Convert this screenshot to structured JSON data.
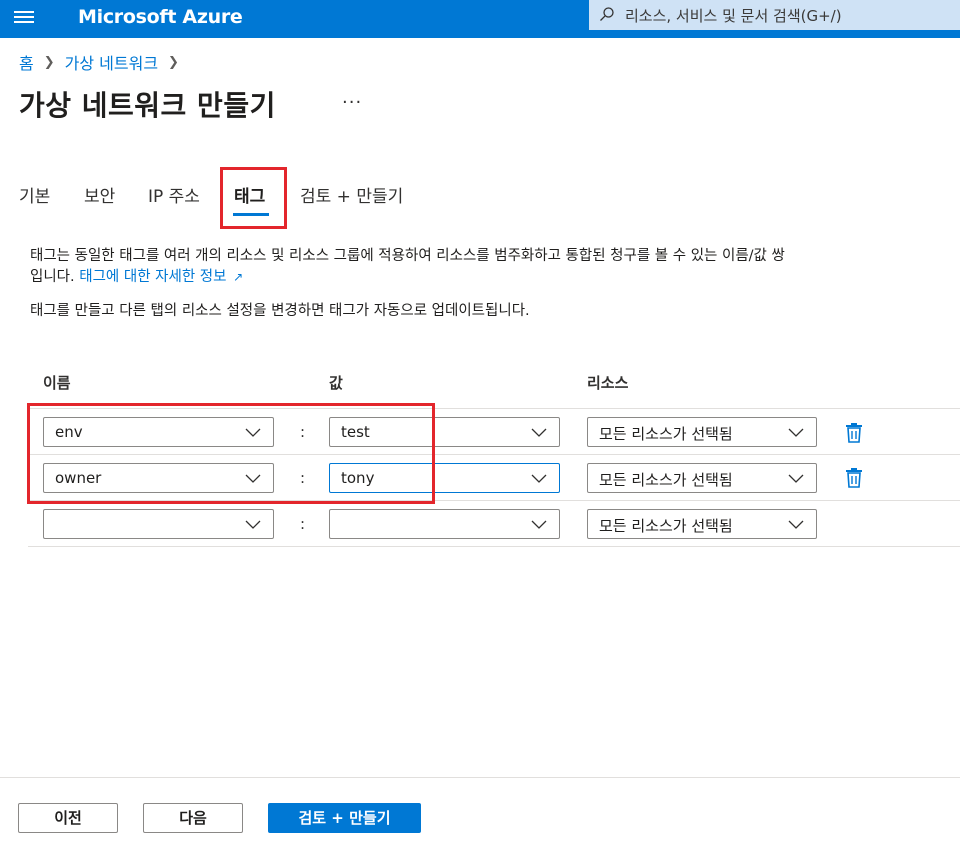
{
  "topbar": {
    "brand": "Microsoft Azure",
    "search_placeholder": "리소스, 서비스 및 문서 검색(G+/)"
  },
  "breadcrumb": {
    "home": "홈",
    "current": "가상 네트워크"
  },
  "page": {
    "title": "가상 네트워크 만들기",
    "more": "···"
  },
  "tabs": [
    {
      "label": "기본"
    },
    {
      "label": "보안"
    },
    {
      "label": "IP 주소"
    },
    {
      "label": "태그",
      "active": true
    },
    {
      "label": "검토 + 만들기"
    }
  ],
  "description": {
    "line1": "태그는 동일한 태그를 여러 개의 리소스 및 리소스 그룹에 적용하여 리소스를 범주화하고 통합된 청구를 볼 수 있는 이름/값 쌍",
    "line2_prefix": "입니다.",
    "link": "태그에 대한 자세한 정보",
    "note": "태그를 만들고 다른 탭의 리소스 설정을 변경하면 태그가 자동으로 업데이트됩니다."
  },
  "table": {
    "headers": {
      "name": "이름",
      "value": "값",
      "resource": "리소스"
    },
    "separator": ":",
    "rows": [
      {
        "name": "env",
        "value": "test",
        "resource": "모든 리소스가 선택됨"
      },
      {
        "name": "owner",
        "value": "tony",
        "resource": "모든 리소스가 선택됨"
      },
      {
        "name": "",
        "value": "",
        "resource": "모든 리소스가 선택됨"
      }
    ]
  },
  "footer": {
    "prev": "이전",
    "next": "다음",
    "review": "검토 + 만들기"
  },
  "colors": {
    "azure_blue": "#0078d4",
    "highlight_red": "#e3262c",
    "search_bg": "#cfe2f5"
  },
  "icons": [
    "hamburger-icon",
    "search-icon",
    "chevron-right-icon",
    "more-icon",
    "external-link-icon",
    "chevron-down-icon",
    "trash-icon"
  ]
}
